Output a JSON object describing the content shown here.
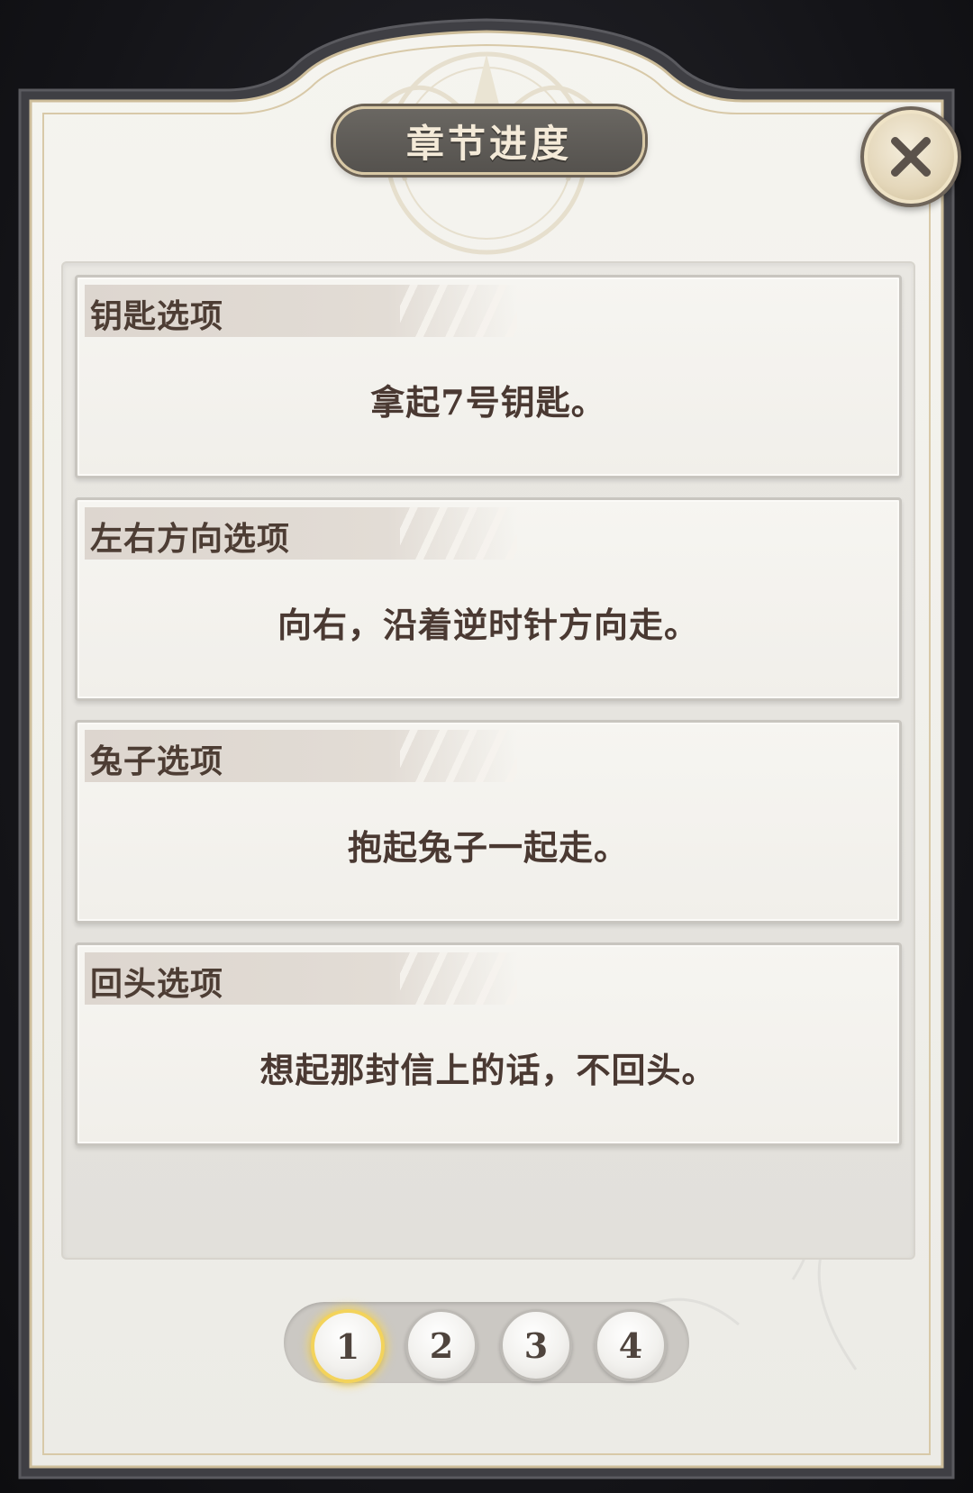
{
  "dialog": {
    "title": "章节进度",
    "close_icon": "close-x-icon"
  },
  "options": [
    {
      "label": "钥匙选项",
      "text": "拿起7号钥匙。"
    },
    {
      "label": "左右方向选项",
      "text": "向右，沿着逆时针方向走。"
    },
    {
      "label": "兔子选项",
      "text": "抱起兔子一起走。"
    },
    {
      "label": "回头选项",
      "text": "想起那封信上的话，不回头。"
    }
  ],
  "pagination": {
    "pages": [
      "1",
      "2",
      "3",
      "4"
    ],
    "active_page": "1"
  },
  "colors": {
    "accent_gold": "#f3d35b",
    "title_plaque": "#5a5752",
    "text_brown": "#4a3932"
  }
}
